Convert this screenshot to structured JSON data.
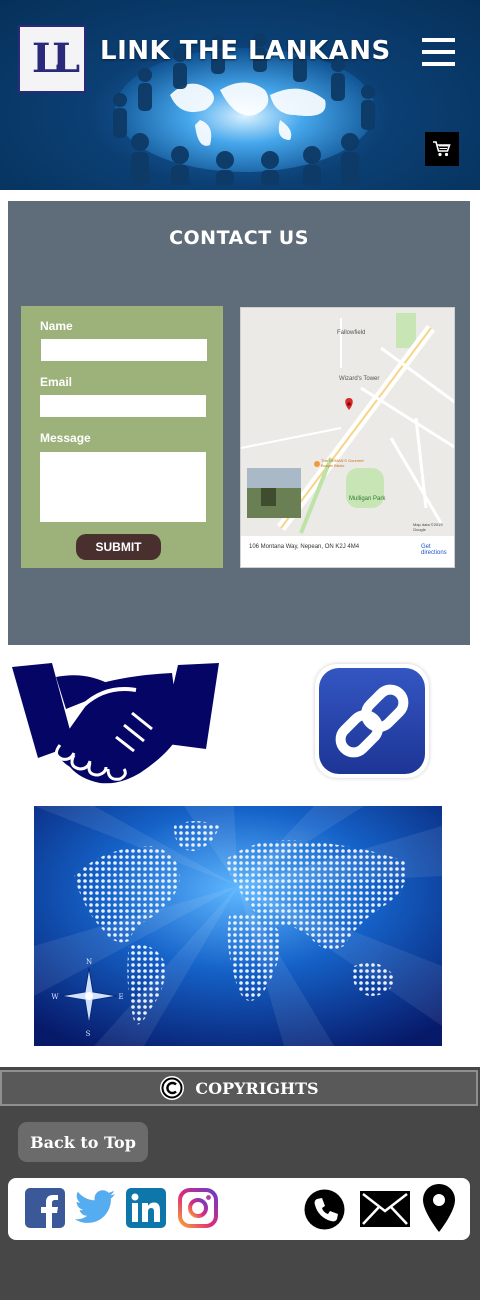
{
  "header": {
    "logo_text": "LL",
    "site_title": "LINK THE LANKANS",
    "menu_icon": "hamburger-menu-icon",
    "cart_icon": "shopping-cart-icon"
  },
  "contact": {
    "title": "CONTACT US",
    "form": {
      "name_label": "Name",
      "name_value": "",
      "email_label": "Email",
      "email_value": "",
      "message_label": "Message",
      "message_value": "",
      "submit_label": "SUBMIT"
    },
    "map": {
      "address": "106 Montana Way, Nepean, ON K2J 4M4",
      "directions_label": "Get directions",
      "credit": "Map data ©2019 Google",
      "places": [
        "Fallowfield",
        "Wizard's Tower",
        "Mulligan Park",
        "The NEMAN'S Gourmet Burger Bistro"
      ]
    }
  },
  "images": {
    "handshake": "handshake-icon",
    "link": "chain-link-icon",
    "world": "world-map-image",
    "compass_letters": [
      "N",
      "E",
      "S",
      "W"
    ]
  },
  "footer": {
    "copyright_label": "COPYRIGHTS",
    "copyright_icon": "copyright-icon",
    "back_to_top": "Back to Top",
    "social": [
      "facebook-icon",
      "twitter-icon",
      "linkedin-icon",
      "instagram-icon"
    ],
    "contact_icons": [
      "phone-icon",
      "email-icon",
      "location-pin-icon"
    ]
  },
  "colors": {
    "header_bg": "#0b3f73",
    "contact_bg": "#5f6d7b",
    "form_bg": "#9db27a",
    "submit_bg": "#4a2f2f",
    "footer_bg": "#474747",
    "handshake": "#050566",
    "link_icon": "#2a45a6"
  }
}
